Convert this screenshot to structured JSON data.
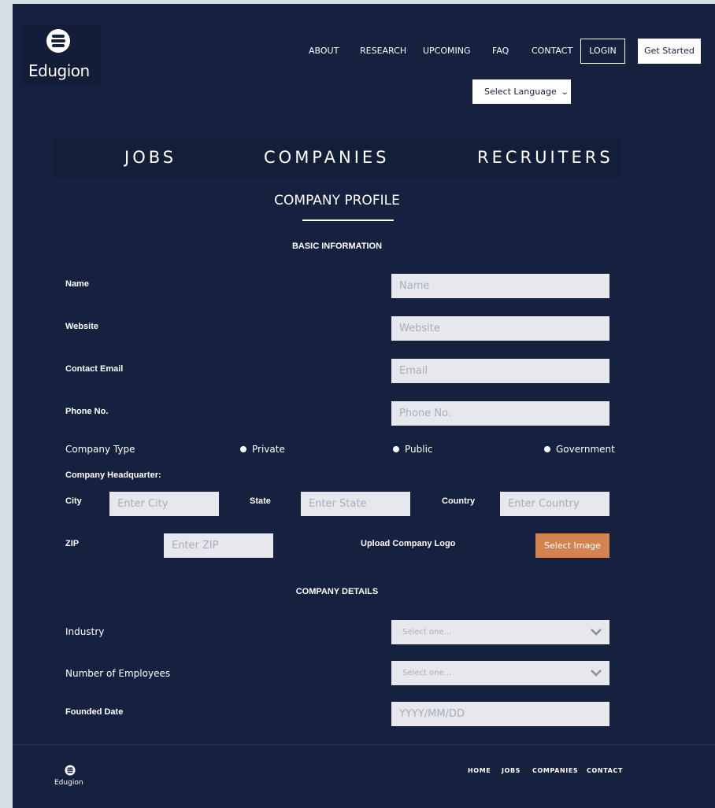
{
  "brand": {
    "name": "Edugion"
  },
  "nav": {
    "items": [
      "ABOUT",
      "RESEARCH",
      "UPCOMING",
      "FAQ",
      "CONTACT"
    ],
    "login": "LOGIN",
    "get_started": "Get Started",
    "language": "Select Language"
  },
  "tabs": [
    "JOBS",
    "COMPANIES",
    "RECRUITERS"
  ],
  "page_title": "COMPANY PROFILE",
  "basic": {
    "heading": "BASIC INFORMATION",
    "name_label": "Name",
    "name_placeholder": "Name",
    "website_label": "Website",
    "website_placeholder": "Website",
    "email_label": "Contact Email",
    "email_placeholder": "Email",
    "phone_label": "Phone No.",
    "phone_placeholder": "Phone No.",
    "type_label": "Company Type",
    "type_options": [
      "Private",
      "Public",
      "Government"
    ],
    "hq_label": "Company Headquarter:",
    "city_label": "City",
    "city_placeholder": "Enter City",
    "state_label": "State",
    "state_placeholder": "Enter State",
    "country_label": "Country",
    "country_placeholder": "Enter Country",
    "zip_label": "ZIP",
    "zip_placeholder": "Enter ZIP",
    "logo_label": "Upload Company Logo",
    "select_image": "Select Image"
  },
  "details": {
    "heading": "COMPANY DETAILS",
    "industry_label": "Industry",
    "industry_value": "Select one...",
    "employees_label": "Number of Employees",
    "employees_value": "Select one...",
    "founded_label": "Founded Date",
    "founded_placeholder": "YYYY/MM/DD"
  },
  "footer": {
    "brand": "Edugion",
    "links": [
      "HOME",
      "JOBS",
      "COMPANIES",
      "CONTACT"
    ]
  },
  "colors": {
    "background": "#15213f",
    "accent": "#d2834f",
    "input": "#e6e8ee",
    "outer": "#d3dfe5"
  },
  "icons": {
    "logo": "stacked-books-icon",
    "chevron": "chevron-down-icon"
  }
}
